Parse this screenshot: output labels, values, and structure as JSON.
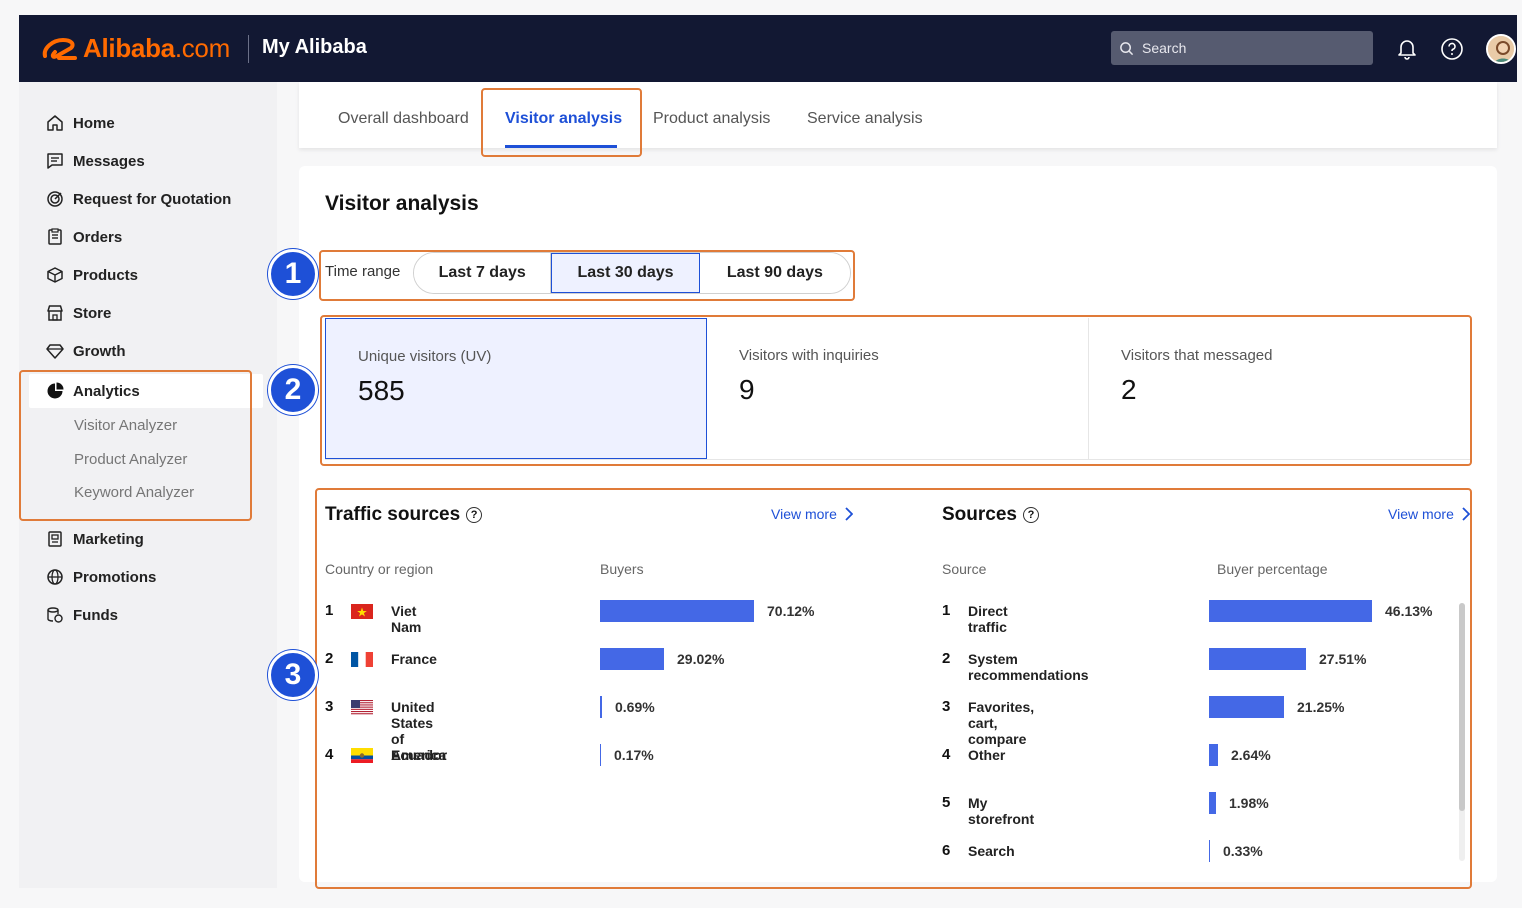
{
  "header": {
    "logo_text": "Alibaba",
    "logo_suffix": ".com",
    "brand": "My Alibaba",
    "search_placeholder": "Search",
    "icons": [
      "bell-icon",
      "help-icon",
      "avatar"
    ]
  },
  "sidebar": {
    "items": [
      {
        "label": "Home",
        "icon": "home-icon"
      },
      {
        "label": "Messages",
        "icon": "message-icon"
      },
      {
        "label": "Request for Quotation",
        "icon": "target-icon"
      },
      {
        "label": "Orders",
        "icon": "clipboard-icon"
      },
      {
        "label": "Products",
        "icon": "box-icon"
      },
      {
        "label": "Store",
        "icon": "store-icon"
      },
      {
        "label": "Growth",
        "icon": "diamond-icon"
      },
      {
        "label": "Analytics",
        "icon": "pie-chart-icon",
        "active": true
      },
      {
        "label": "Marketing",
        "icon": "marketing-icon"
      },
      {
        "label": "Promotions",
        "icon": "globe-icon"
      },
      {
        "label": "Funds",
        "icon": "funds-icon"
      }
    ],
    "analytics_sub": [
      "Visitor Analyzer",
      "Product Analyzer",
      "Keyword Analyzer"
    ]
  },
  "tabs": [
    {
      "label": "Overall dashboard"
    },
    {
      "label": "Visitor analysis",
      "active": true
    },
    {
      "label": "Product analysis"
    },
    {
      "label": "Service analysis"
    }
  ],
  "main": {
    "title": "Visitor analysis",
    "time_range_label": "Time range",
    "time_ranges": [
      "Last 7 days",
      "Last 30 days",
      "Last 90 days"
    ],
    "selected_range": "Last 30 days",
    "metrics": [
      {
        "label": "Unique visitors (UV)",
        "value": "585"
      },
      {
        "label": "Visitors with inquiries",
        "value": "9"
      },
      {
        "label": "Visitors that messaged",
        "value": "2"
      }
    ]
  },
  "traffic_sources": {
    "title": "Traffic sources",
    "view_more": "View more",
    "col_region": "Country or region",
    "col_buyers": "Buyers",
    "rows": [
      {
        "rank": "1",
        "name": "Viet Nam",
        "pct": "70.12%",
        "value": 70.12,
        "flag": "vn"
      },
      {
        "rank": "2",
        "name": "France",
        "pct": "29.02%",
        "value": 29.02,
        "flag": "fr"
      },
      {
        "rank": "3",
        "name": "United States of America",
        "pct": "0.69%",
        "value": 0.69,
        "flag": "us"
      },
      {
        "rank": "4",
        "name": "Ecuador",
        "pct": "0.17%",
        "value": 0.17,
        "flag": "ec"
      }
    ]
  },
  "sources": {
    "title": "Sources",
    "view_more": "View more",
    "col_source": "Source",
    "col_pct": "Buyer percentage",
    "rows": [
      {
        "rank": "1",
        "name": "Direct traffic",
        "pct": "46.13%",
        "value": 46.13
      },
      {
        "rank": "2",
        "name": "System recommendations",
        "pct": "27.51%",
        "value": 27.51
      },
      {
        "rank": "3",
        "name": "Favorites, cart, compare",
        "pct": "21.25%",
        "value": 21.25
      },
      {
        "rank": "4",
        "name": "Other",
        "pct": "2.64%",
        "value": 2.64
      },
      {
        "rank": "5",
        "name": "My storefront",
        "pct": "1.98%",
        "value": 1.98
      },
      {
        "rank": "6",
        "name": "Search",
        "pct": "0.33%",
        "value": 0.33
      }
    ]
  },
  "annotations": [
    "1",
    "2",
    "3"
  ],
  "colors": {
    "accent": "#1e50d7",
    "bar": "#4468e6",
    "annotation": "#e07b39",
    "header": "#121833",
    "brand_orange": "#ff6a00"
  }
}
